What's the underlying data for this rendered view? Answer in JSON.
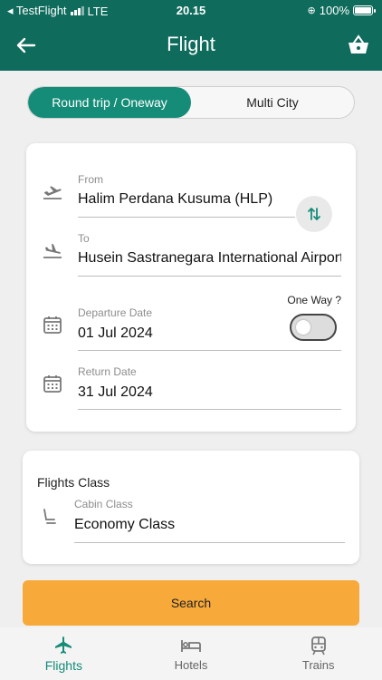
{
  "status_bar": {
    "carrier": "◂ TestFlight",
    "network": "LTE",
    "time": "20.15",
    "battery": "100%"
  },
  "header": {
    "title": "Flight",
    "back_icon": "arrow-left-icon",
    "basket_icon": "basket-icon"
  },
  "trip_type": {
    "options": [
      "Round trip / Oneway",
      "Multi City"
    ],
    "selected": "Round trip / Oneway"
  },
  "route": {
    "from_label": "From",
    "from_value": "Halim Perdana Kusuma (HLP)",
    "to_label": "To",
    "to_value": "Husein Sastranegara International Airport",
    "swap_icon": "swap-vertical-icon"
  },
  "dates": {
    "oneway_label": "One Way ?",
    "oneway_enabled": false,
    "departure_label": "Departure Date",
    "departure_value": "01 Jul 2024",
    "return_label": "Return Date",
    "return_value": "31 Jul 2024"
  },
  "flight_class": {
    "title": "Flights Class",
    "cabin_label": "Cabin Class",
    "cabin_value": "Economy Class"
  },
  "search_button": "Search",
  "tabbar": {
    "items": [
      {
        "label": "Flights",
        "icon": "airplane-icon"
      },
      {
        "label": "Hotels",
        "icon": "bed-icon"
      },
      {
        "label": "Trains",
        "icon": "train-icon"
      }
    ],
    "active": "Flights"
  },
  "colors": {
    "header": "#0f6b5c",
    "accent": "#158c78",
    "search_button": "#f7a93a"
  }
}
